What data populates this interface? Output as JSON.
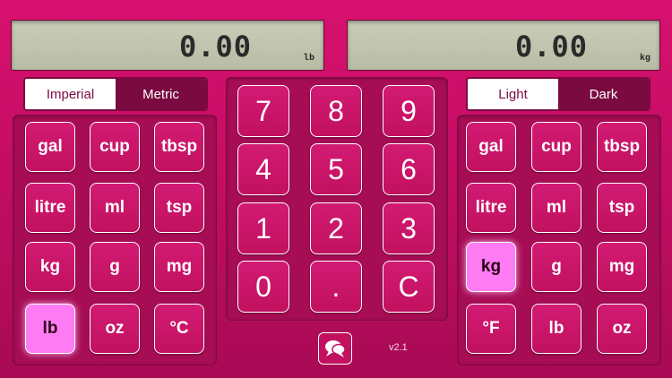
{
  "left_display": {
    "value": "0.00",
    "unit": "lb"
  },
  "right_display": {
    "value": "0.00",
    "unit": "kg"
  },
  "system_toggle": {
    "option1": "Imperial",
    "option2": "Metric",
    "selected": "Imperial"
  },
  "theme_toggle": {
    "option1": "Light",
    "option2": "Dark",
    "selected": "Light"
  },
  "left_units": [
    "gal",
    "cup",
    "tbsp",
    "litre",
    "ml",
    "tsp",
    "kg",
    "g",
    "mg",
    "lb",
    "oz",
    "°C"
  ],
  "left_selected": "lb",
  "right_units": [
    "gal",
    "cup",
    "tbsp",
    "litre",
    "ml",
    "tsp",
    "kg",
    "g",
    "mg",
    "°F",
    "lb",
    "oz"
  ],
  "right_selected": "kg",
  "keypad": [
    "7",
    "8",
    "9",
    "4",
    "5",
    "6",
    "1",
    "2",
    "3",
    "0",
    ".",
    "C"
  ],
  "share_icon": "share-bubble-icon",
  "version": "v2.1",
  "colors": {
    "background": "#c40d63",
    "panel": "#a70d55",
    "accent_dark": "#7a0a40",
    "selected_key": "#ff7bf3",
    "lcd": "#c4c8b2"
  }
}
